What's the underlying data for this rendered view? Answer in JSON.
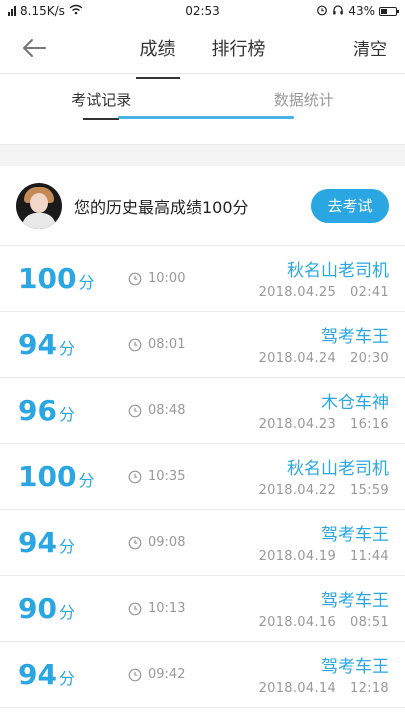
{
  "status_bar": {
    "signal_text": "iil",
    "network_speed": "8.15K/s",
    "time": "02:53",
    "battery_text": "43%",
    "battery_level": 0.43
  },
  "header": {
    "tabs": [
      {
        "label": "成绩",
        "active": true
      },
      {
        "label": "排行榜",
        "active": false
      }
    ],
    "clear_label": "清空"
  },
  "sub_tabs": [
    {
      "label": "考试记录",
      "active": true
    },
    {
      "label": "数据统计",
      "active": false
    }
  ],
  "best": {
    "text": "您的历史最高成绩100分",
    "button_label": "去考试"
  },
  "score_unit": "分",
  "records": [
    {
      "score": "100",
      "duration": "10:00",
      "title": "秋名山老司机",
      "date": "2018.04.25",
      "time": "02:41"
    },
    {
      "score": "94",
      "duration": "08:01",
      "title": "驾考车王",
      "date": "2018.04.24",
      "time": "20:30"
    },
    {
      "score": "96",
      "duration": "08:48",
      "title": "木仓车神",
      "date": "2018.04.23",
      "time": "16:16"
    },
    {
      "score": "100",
      "duration": "10:35",
      "title": "秋名山老司机",
      "date": "2018.04.22",
      "time": "15:59"
    },
    {
      "score": "94",
      "duration": "09:08",
      "title": "驾考车王",
      "date": "2018.04.19",
      "time": "11:44"
    },
    {
      "score": "90",
      "duration": "10:13",
      "title": "驾考车王",
      "date": "2018.04.16",
      "time": "08:51"
    },
    {
      "score": "94",
      "duration": "09:42",
      "title": "驾考车王",
      "date": "2018.04.14",
      "time": "12:18"
    }
  ],
  "colors": {
    "accent": "#2aa7e2",
    "muted": "#999999"
  }
}
